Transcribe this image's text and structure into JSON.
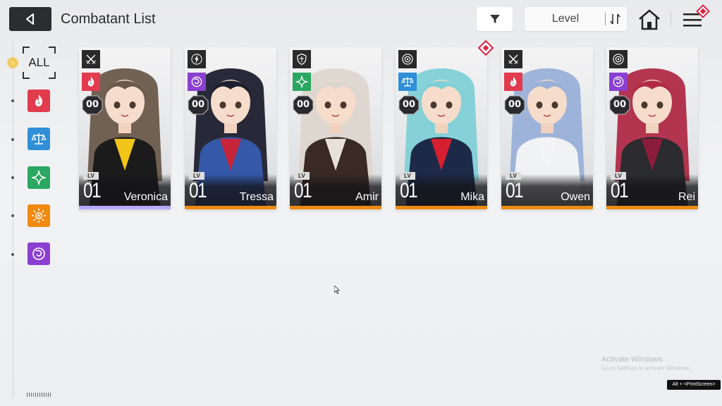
{
  "header": {
    "title": "Combatant List",
    "sort_label": "Level"
  },
  "sidebar": {
    "all_label": "ALL",
    "filters": [
      {
        "name": "fire",
        "color": "#e23b4e",
        "icon": "flame-icon"
      },
      {
        "name": "balance",
        "color": "#2f8fd8",
        "icon": "scales-icon"
      },
      {
        "name": "wind",
        "color": "#2aa760",
        "icon": "star-cross-icon"
      },
      {
        "name": "sun",
        "color": "#f08a10",
        "icon": "sun-icon"
      },
      {
        "name": "void",
        "color": "#8a3fd0",
        "icon": "swirl-icon"
      }
    ]
  },
  "cards": [
    {
      "name": "Veronica",
      "lv_label": "LV",
      "level": "01",
      "rank": "00",
      "class_icon": "crossed-swords-icon",
      "element": "fire",
      "element_color": "#e23b4e",
      "rarity_color": "#b9a7ff",
      "accent": "#f2c41a",
      "hair": "#6a5a4a",
      "outfit": "#1b1b1b",
      "new": false
    },
    {
      "name": "Tressa",
      "lv_label": "LV",
      "level": "01",
      "rank": "00",
      "class_icon": "lightning-icon",
      "element": "void",
      "element_color": "#8a3fd0",
      "rarity_color": "#f08a10",
      "accent": "#c8243a",
      "hair": "#1c1f2e",
      "outfit": "#3558a8",
      "new": false
    },
    {
      "name": "Amir",
      "lv_label": "LV",
      "level": "01",
      "rank": "00",
      "class_icon": "shield-icon",
      "element": "wind",
      "element_color": "#2aa760",
      "rarity_color": "#f08a10",
      "accent": "#e8e1d9",
      "hair": "#ddd6cf",
      "outfit": "#3a2a24",
      "new": false
    },
    {
      "name": "Mika",
      "lv_label": "LV",
      "level": "01",
      "rank": "00",
      "class_icon": "target-icon",
      "element": "balance",
      "element_color": "#2f8fd8",
      "rarity_color": "#f08a10",
      "accent": "#d62030",
      "hair": "#7fd0d6",
      "outfit": "#1c2a48",
      "new": true
    },
    {
      "name": "Owen",
      "lv_label": "LV",
      "level": "01",
      "rank": "00",
      "class_icon": "crossed-swords-icon",
      "element": "fire",
      "element_color": "#e23b4e",
      "rarity_color": "#f08a10",
      "accent": "#f4f4f6",
      "hair": "#9ab0d8",
      "outfit": "#f1f2f4",
      "new": false
    },
    {
      "name": "Rei",
      "lv_label": "LV",
      "level": "01",
      "rank": "00",
      "class_icon": "target-icon",
      "element": "void",
      "element_color": "#8a3fd0",
      "rarity_color": "#f08a10",
      "accent": "#8b1d3a",
      "hair": "#b02a46",
      "outfit": "#2b2b30",
      "new": false
    }
  ],
  "watermark": {
    "line1": "Activate Windows",
    "line2": "Go to Settings to activate Windows.",
    "shortcut": "Alt + <PrintScreen>"
  }
}
